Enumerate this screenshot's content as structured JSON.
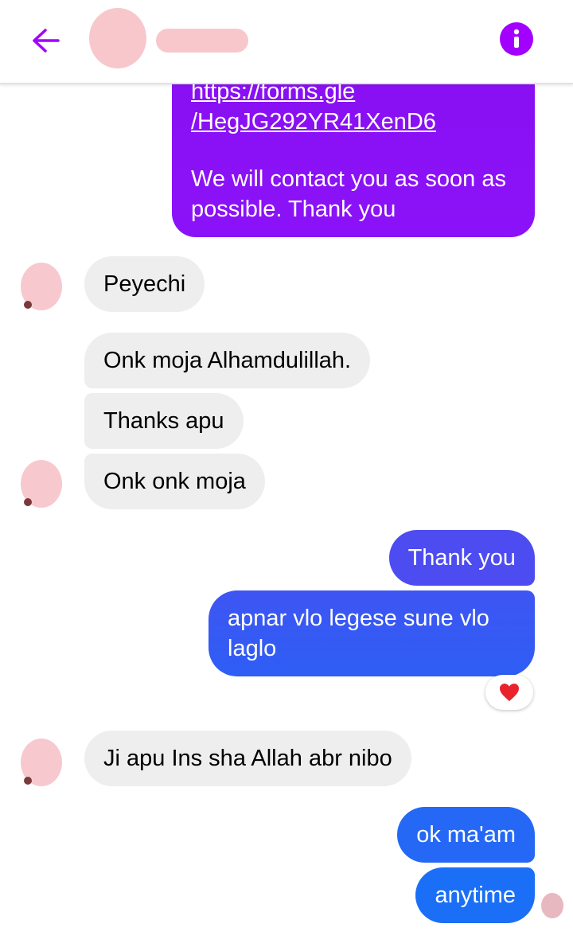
{
  "header": {
    "back_icon": "arrow-left-icon",
    "info_icon": "info-icon",
    "accent_color": "#a200ff"
  },
  "messages": {
    "link_partial": "https://forms.gle",
    "link_full": "/HegJG292YR41XenD6",
    "contact_text": "We will contact you as soon as possible. Thank you",
    "m1": "Peyechi",
    "m2": "Onk moja Alhamdulillah.",
    "m3": "Thanks apu",
    "m4": "Onk onk moja",
    "m5": "Thank you",
    "m6": "apnar vlo legese sune vlo laglo",
    "m7": "Ji apu Ins sha Allah abr nibo",
    "m8": "ok ma'am",
    "m9": "anytime"
  },
  "reaction": {
    "icon": "heart-icon",
    "color": "#e8232b"
  },
  "colors": {
    "outgoing_gradient_top": "#5b44f2",
    "outgoing_gradient_bottom": "#1f6cf5",
    "incoming": "#eeeeee"
  }
}
